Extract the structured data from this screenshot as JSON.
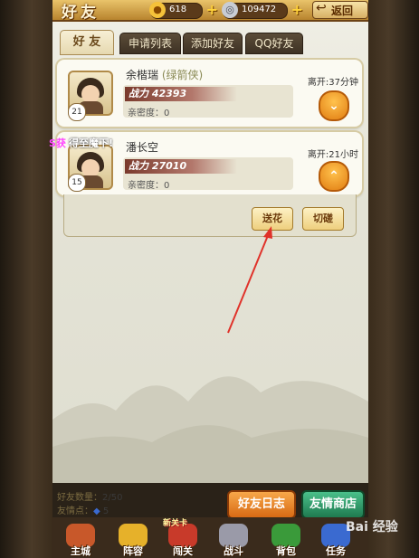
{
  "header": {
    "title": "好友",
    "gold": "618",
    "silver": "109472",
    "back_label": "返回"
  },
  "tabs": [
    "好 友",
    "申请列表",
    "添加好友",
    "QQ好友"
  ],
  "friends": [
    {
      "name": "余楷瑞",
      "tag": "(绿箭侠)",
      "level": "21",
      "power": "战力 42393",
      "intimacy": "亲密度：0",
      "leave": "离开:37分钟"
    },
    {
      "name": "潘长空",
      "tag": "",
      "level": "15",
      "power": "战力 27010",
      "intimacy": "亲密度：0",
      "leave": "离开:21小时"
    }
  ],
  "actions": {
    "flower": "送花",
    "spar": "切磋"
  },
  "chat": {
    "prefix": "S获",
    "message": "得至魔下!"
  },
  "stats": {
    "count_label": "好友数量：",
    "count": "2/50",
    "points_label": "友情点：",
    "points": "5"
  },
  "buttons": {
    "log": "好友日志",
    "shop": "友情商店"
  },
  "nav": [
    {
      "label": "主城"
    },
    {
      "label": "阵容"
    },
    {
      "label": "闯关",
      "badge": "新关卡"
    },
    {
      "label": "战斗"
    },
    {
      "label": "背包"
    },
    {
      "label": "任务"
    }
  ],
  "watermark": "Bai 经验",
  "colors": {
    "accent": "#e17d12",
    "gold": "#e9c36a",
    "green_btn": "#2f9a6a",
    "orange_btn": "#e68a2a"
  }
}
